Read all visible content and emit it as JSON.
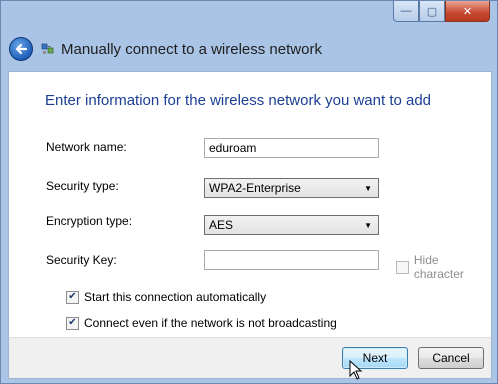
{
  "window": {
    "caption": {
      "minimize_glyph": "—",
      "maximize_glyph": "▢",
      "close_glyph": "✕"
    }
  },
  "header": {
    "title": "Manually connect to a wireless network",
    "back_icon": "back-arrow-icon",
    "network_icon": "wireless-network-icon"
  },
  "main": {
    "instruction": "Enter information for the wireless network you want to add",
    "network_name": {
      "label": "Network name:",
      "value": "eduroam"
    },
    "security_type": {
      "label": "Security type:",
      "value": "WPA2-Enterprise"
    },
    "encryption_type": {
      "label": "Encryption type:",
      "value": "AES"
    },
    "security_key": {
      "label": "Security Key:",
      "value": "",
      "hide_label": "Hide character"
    },
    "auto_start": {
      "label": "Start this connection automatically",
      "checked": true
    },
    "broadcast": {
      "label": "Connect even if the network is not broadcasting",
      "checked": true
    }
  },
  "footer": {
    "next_label": "Next",
    "cancel_label": "Cancel"
  },
  "colors": {
    "instruction_text": "#1c3f94",
    "window_frame": "#aac4e6",
    "close_button": "#c7472f"
  }
}
